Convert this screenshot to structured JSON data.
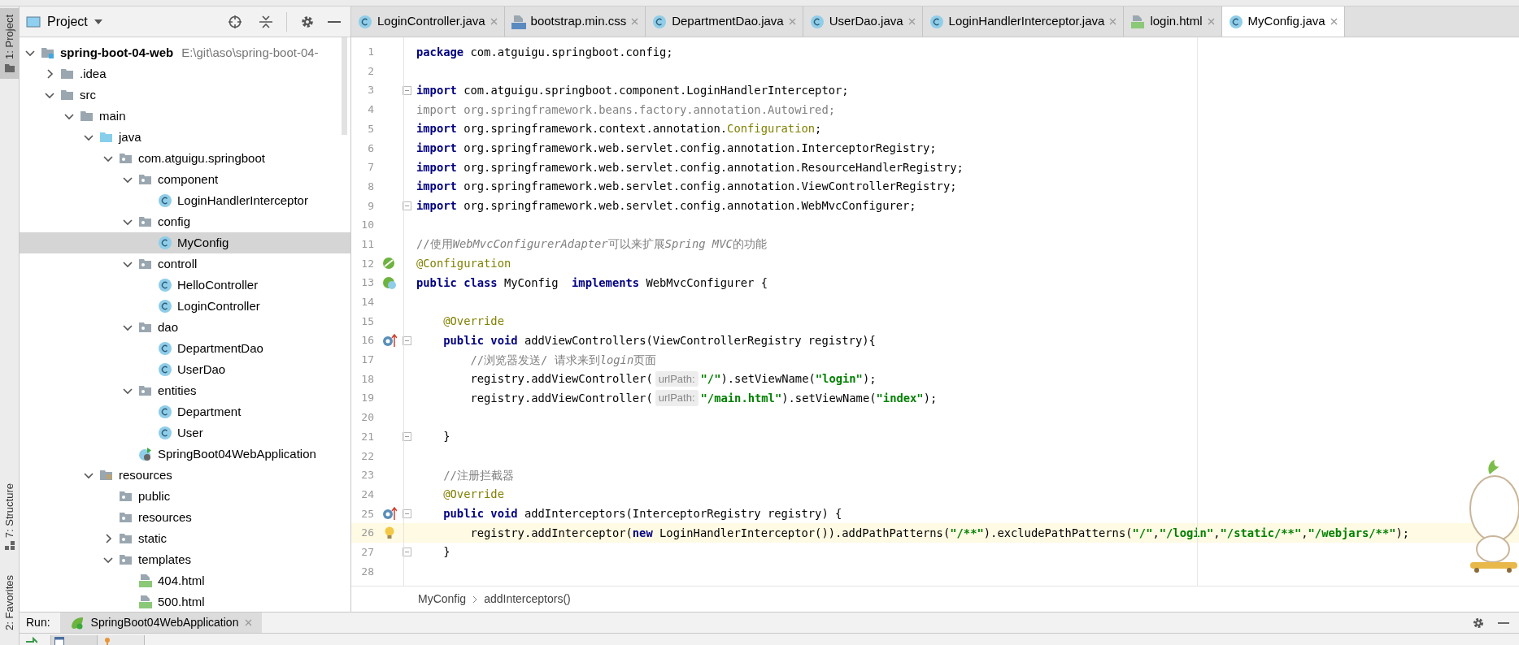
{
  "side_tabs": [
    {
      "label": "1: Project",
      "selected": true,
      "kind": "project"
    },
    {
      "label": "7: Structure",
      "selected": false,
      "kind": "structure"
    },
    {
      "label": "2: Favorites",
      "selected": false,
      "kind": "favorites"
    }
  ],
  "project_panel": {
    "title": "Project"
  },
  "tree": [
    {
      "kind": "module",
      "label": "spring-boot-04-web",
      "path": "E:\\git\\aso\\spring-boot-04-",
      "expanded": true,
      "selected": false,
      "children": [
        {
          "kind": "folder",
          "label": ".idea",
          "expanded": false,
          "selected": false
        },
        {
          "kind": "folder",
          "label": "src",
          "expanded": true,
          "selected": false,
          "children": [
            {
              "kind": "folder",
              "label": "main",
              "expanded": true,
              "selected": false,
              "children": [
                {
                  "kind": "source",
                  "label": "java",
                  "expanded": true,
                  "selected": false,
                  "children": [
                    {
                      "kind": "package",
                      "label": "com.atguigu.springboot",
                      "expanded": true,
                      "selected": false,
                      "children": [
                        {
                          "kind": "package",
                          "label": "component",
                          "expanded": true,
                          "selected": false,
                          "children": [
                            {
                              "kind": "class",
                              "label": "LoginHandlerInterceptor",
                              "selected": false
                            }
                          ]
                        },
                        {
                          "kind": "package",
                          "label": "config",
                          "expanded": true,
                          "selected": false,
                          "children": [
                            {
                              "kind": "class",
                              "label": "MyConfig",
                              "selected": true
                            }
                          ]
                        },
                        {
                          "kind": "package",
                          "label": "controll",
                          "expanded": true,
                          "selected": false,
                          "children": [
                            {
                              "kind": "class",
                              "label": "HelloController",
                              "selected": false
                            },
                            {
                              "kind": "class",
                              "label": "LoginController",
                              "selected": false
                            }
                          ]
                        },
                        {
                          "kind": "package",
                          "label": "dao",
                          "expanded": true,
                          "selected": false,
                          "children": [
                            {
                              "kind": "class",
                              "label": "DepartmentDao",
                              "selected": false
                            },
                            {
                              "kind": "class",
                              "label": "UserDao",
                              "selected": false
                            }
                          ]
                        },
                        {
                          "kind": "package",
                          "label": "entities",
                          "expanded": true,
                          "selected": false,
                          "children": [
                            {
                              "kind": "class",
                              "label": "Department",
                              "selected": false
                            },
                            {
                              "kind": "class",
                              "label": "User",
                              "selected": false
                            }
                          ]
                        },
                        {
                          "kind": "app",
                          "label": "SpringBoot04WebApplication",
                          "selected": false
                        }
                      ]
                    }
                  ]
                },
                {
                  "kind": "resources",
                  "label": "resources",
                  "expanded": true,
                  "selected": false,
                  "children": [
                    {
                      "kind": "package",
                      "label": "public",
                      "selected": false
                    },
                    {
                      "kind": "package",
                      "label": "resources",
                      "selected": false
                    },
                    {
                      "kind": "package",
                      "label": "static",
                      "expanded": false,
                      "selected": false
                    },
                    {
                      "kind": "package",
                      "label": "templates",
                      "expanded": true,
                      "selected": false,
                      "children": [
                        {
                          "kind": "html",
                          "label": "404.html",
                          "selected": false
                        },
                        {
                          "kind": "html",
                          "label": "500.html",
                          "selected": false
                        }
                      ]
                    }
                  ]
                }
              ]
            }
          ]
        }
      ]
    }
  ],
  "tabs": [
    {
      "label": "LoginController.java",
      "kind": "java",
      "selected": false
    },
    {
      "label": "bootstrap.min.css",
      "kind": "css",
      "selected": false
    },
    {
      "label": "DepartmentDao.java",
      "kind": "java",
      "selected": false
    },
    {
      "label": "UserDao.java",
      "kind": "java",
      "selected": false
    },
    {
      "label": "LoginHandlerInterceptor.java",
      "kind": "java",
      "selected": false
    },
    {
      "label": "login.html",
      "kind": "html",
      "selected": false
    },
    {
      "label": "MyConfig.java",
      "kind": "java",
      "selected": true
    }
  ],
  "code_lines": [
    {
      "number": "1",
      "segments": [
        {
          "kind": "keyword",
          "text": "package"
        },
        {
          "kind": "plain",
          "text": " com.atguigu.springboot.config;"
        }
      ]
    },
    {
      "number": "2"
    },
    {
      "number": "3",
      "fold": true,
      "segments": [
        {
          "kind": "keyword",
          "text": "import"
        },
        {
          "kind": "plain",
          "text": " com.atguigu.springboot.component.LoginHandlerInterceptor;"
        }
      ]
    },
    {
      "number": "4",
      "segments": [
        {
          "kind": "unused",
          "text": "import org.springframework.beans.factory.annotation.Autowired;"
        }
      ]
    },
    {
      "number": "5",
      "segments": [
        {
          "kind": "keyword",
          "text": "import"
        },
        {
          "kind": "plain",
          "text": " org.springframework.context.annotation."
        },
        {
          "kind": "annotation",
          "text": "Configuration"
        },
        {
          "kind": "plain",
          "text": ";"
        }
      ]
    },
    {
      "number": "6",
      "segments": [
        {
          "kind": "keyword",
          "text": "import"
        },
        {
          "kind": "plain",
          "text": " org.springframework.web.servlet.config.annotation.InterceptorRegistry;"
        }
      ]
    },
    {
      "number": "7",
      "segments": [
        {
          "kind": "keyword",
          "text": "import"
        },
        {
          "kind": "plain",
          "text": " org.springframework.web.servlet.config.annotation.ResourceHandlerRegistry;"
        }
      ]
    },
    {
      "number": "8",
      "segments": [
        {
          "kind": "keyword",
          "text": "import"
        },
        {
          "kind": "plain",
          "text": " org.springframework.web.servlet.config.annotation.ViewControllerRegistry;"
        }
      ]
    },
    {
      "number": "9",
      "fold": true,
      "segments": [
        {
          "kind": "keyword",
          "text": "import"
        },
        {
          "kind": "plain",
          "text": " org.springframework.web.servlet.config.annotation.WebMvcConfigurer;"
        }
      ]
    },
    {
      "number": "10"
    },
    {
      "number": "11",
      "segments": [
        {
          "kind": "comment",
          "text": "//使用"
        },
        {
          "kind": "comment-italic",
          "text": "WebMvcConfigurerAdapter"
        },
        {
          "kind": "comment",
          "text": "可以来扩展"
        },
        {
          "kind": "comment-italic",
          "text": "Spring MVC"
        },
        {
          "kind": "comment",
          "text": "的功能"
        }
      ]
    },
    {
      "number": "12",
      "gutter_marker": {
        "kind": "bean"
      },
      "segments": [
        {
          "kind": "annotation",
          "text": "@Configuration"
        }
      ]
    },
    {
      "number": "13",
      "gutter_marker": {
        "kind": "bean-class"
      },
      "segments": [
        {
          "kind": "keyword",
          "text": "public class"
        },
        {
          "kind": "plain",
          "text": " MyConfig  "
        },
        {
          "kind": "keyword",
          "text": "implements"
        },
        {
          "kind": "plain",
          "text": " WebMvcConfigurer {"
        }
      ]
    },
    {
      "number": "14"
    },
    {
      "number": "15",
      "segments": [
        {
          "kind": "annotation",
          "text": "    @Override"
        }
      ]
    },
    {
      "number": "16",
      "gutter_marker": {
        "kind": "override"
      },
      "fold": true,
      "segments": [
        {
          "kind": "keyword",
          "text": "    public void"
        },
        {
          "kind": "plain",
          "text": " addViewControllers(ViewControllerRegistry registry){"
        }
      ]
    },
    {
      "number": "17",
      "segments": [
        {
          "kind": "comment",
          "text": "        //浏览器发送/ 请求来到"
        },
        {
          "kind": "comment-italic",
          "text": "login"
        },
        {
          "kind": "comment",
          "text": "页面"
        }
      ]
    },
    {
      "number": "18",
      "segments": [
        {
          "kind": "plain",
          "text": "        registry.addViewController("
        },
        {
          "kind": "hint",
          "text": "urlPath:"
        },
        {
          "kind": "string",
          "text": "\"/\""
        },
        {
          "kind": "plain",
          "text": ").setViewName("
        },
        {
          "kind": "string",
          "text": "\"login\""
        },
        {
          "kind": "plain",
          "text": ");"
        }
      ]
    },
    {
      "number": "19",
      "segments": [
        {
          "kind": "plain",
          "text": "        registry.addViewController("
        },
        {
          "kind": "hint",
          "text": "urlPath:"
        },
        {
          "kind": "string",
          "text": "\"/main.html\""
        },
        {
          "kind": "plain",
          "text": ").setViewName("
        },
        {
          "kind": "string",
          "text": "\"index\""
        },
        {
          "kind": "plain",
          "text": ");"
        }
      ]
    },
    {
      "number": "20"
    },
    {
      "number": "21",
      "fold": true,
      "segments": [
        {
          "kind": "plain",
          "text": "    }"
        }
      ]
    },
    {
      "number": "22"
    },
    {
      "number": "23",
      "segments": [
        {
          "kind": "comment",
          "text": "    //注册拦截器"
        }
      ]
    },
    {
      "number": "24",
      "segments": [
        {
          "kind": "annotation",
          "text": "    @Override"
        }
      ]
    },
    {
      "number": "25",
      "gutter_marker": {
        "kind": "override"
      },
      "fold": true,
      "segments": [
        {
          "kind": "keyword",
          "text": "    public void"
        },
        {
          "kind": "plain",
          "text": " addInterceptors(InterceptorRegistry registry) {"
        }
      ]
    },
    {
      "number": "26",
      "gutter_marker": {
        "kind": "bulb"
      },
      "current": true,
      "segments": [
        {
          "kind": "plain",
          "text": "        registry.addInterceptor("
        },
        {
          "kind": "keyword",
          "text": "new"
        },
        {
          "kind": "plain",
          "text": " LoginHandlerInterceptor()).addPathPatterns("
        },
        {
          "kind": "string",
          "text": "\"/**\""
        },
        {
          "kind": "plain",
          "text": ").excludePathPatterns("
        },
        {
          "kind": "string",
          "text": "\"/\""
        },
        {
          "kind": "plain",
          "text": ","
        },
        {
          "kind": "string",
          "text": "\"/login\""
        },
        {
          "kind": "plain",
          "text": ","
        },
        {
          "kind": "string",
          "text": "\"/static/**\""
        },
        {
          "kind": "plain",
          "text": ","
        },
        {
          "kind": "string",
          "text": "\"/webjars/**\""
        },
        {
          "kind": "plain",
          "text": ");"
        }
      ]
    },
    {
      "number": "27",
      "fold": true,
      "segments": [
        {
          "kind": "plain",
          "text": "    }"
        }
      ]
    },
    {
      "number": "28"
    }
  ],
  "breadcrumb": [
    "MyConfig",
    "addInterceptors()"
  ],
  "run_bar": {
    "label": "Run:",
    "tab": "SpringBoot04WebApplication"
  }
}
